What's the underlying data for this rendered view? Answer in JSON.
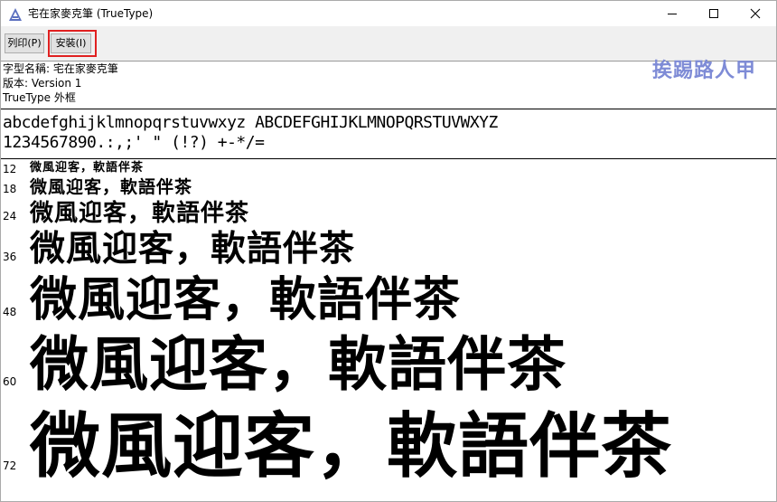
{
  "window": {
    "title": "宅在家麥克筆 (TrueType)",
    "controls": {
      "minimize_icon": "minimize-icon",
      "maximize_icon": "maximize-icon",
      "close_icon": "close-icon"
    }
  },
  "toolbar": {
    "print_label": "列印(P)",
    "install_label": "安裝(I)"
  },
  "watermark": "挨踢路人甲",
  "font_info": {
    "name_line": "字型名稱: 宅在家麥克筆",
    "version_line": "版本: Version 1",
    "type_line": "TrueType 外框"
  },
  "charset": {
    "line1": "abcdefghijklmnopqrstuvwxyz ABCDEFGHIJKLMNOPQRSTUVWXYZ",
    "line2": "1234567890.:,;' \" (!?) +-*/="
  },
  "samples": [
    {
      "size": "12",
      "text": "微風迎客，軟語伴茶"
    },
    {
      "size": "18",
      "text": "微風迎客，軟語伴茶"
    },
    {
      "size": "24",
      "text": "微風迎客，軟語伴茶"
    },
    {
      "size": "36",
      "text": "微風迎客，軟語伴茶"
    },
    {
      "size": "48",
      "text": "微風迎客，軟語伴茶"
    },
    {
      "size": "60",
      "text": "微風迎客，軟語伴茶"
    },
    {
      "size": "72",
      "text": "微風迎客，軟語伴茶"
    }
  ],
  "colors": {
    "highlight": "#e02020",
    "watermark": "#7e8bd6"
  }
}
